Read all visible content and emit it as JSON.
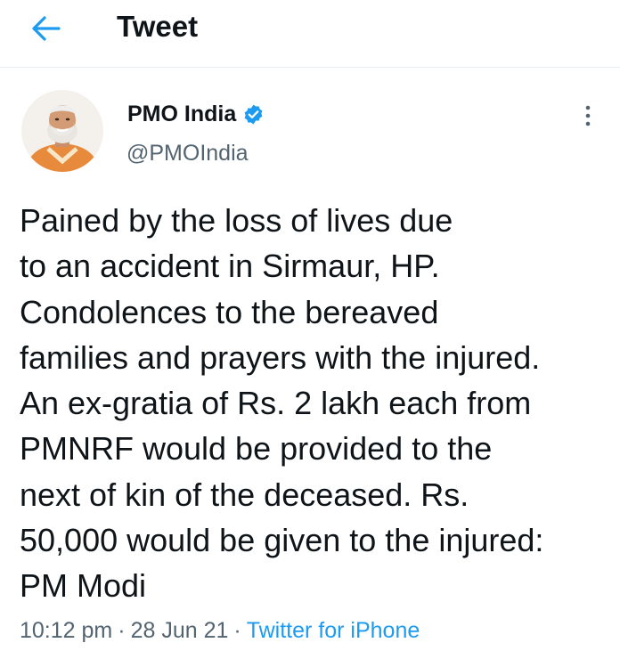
{
  "header": {
    "title": "Tweet",
    "back_icon": "arrow-left-icon",
    "accent_color": "#1d9bf0"
  },
  "tweet": {
    "author": {
      "display_name": "PMO India",
      "handle": "@PMOIndia",
      "verified": true,
      "verified_icon": "verified-badge-icon"
    },
    "text": "Pained by the loss of lives due\nto an accident in Sirmaur, HP.\nCondolences to the bereaved\nfamilies and prayers with the injured.\nAn ex-gratia of Rs. 2 lakh each from\nPMNRF would be provided to the\nnext of kin of the deceased. Rs.\n50,000 would be given to the injured:\nPM Modi",
    "time": "10:12 pm",
    "separator": "·",
    "date": "28 Jun 21",
    "source": "Twitter for iPhone",
    "more_icon": "more-vertical-icon"
  },
  "colors": {
    "text_primary": "#0f1419",
    "text_secondary": "#536471",
    "link": "#1d9bf0",
    "divider": "#e6ecf0"
  }
}
